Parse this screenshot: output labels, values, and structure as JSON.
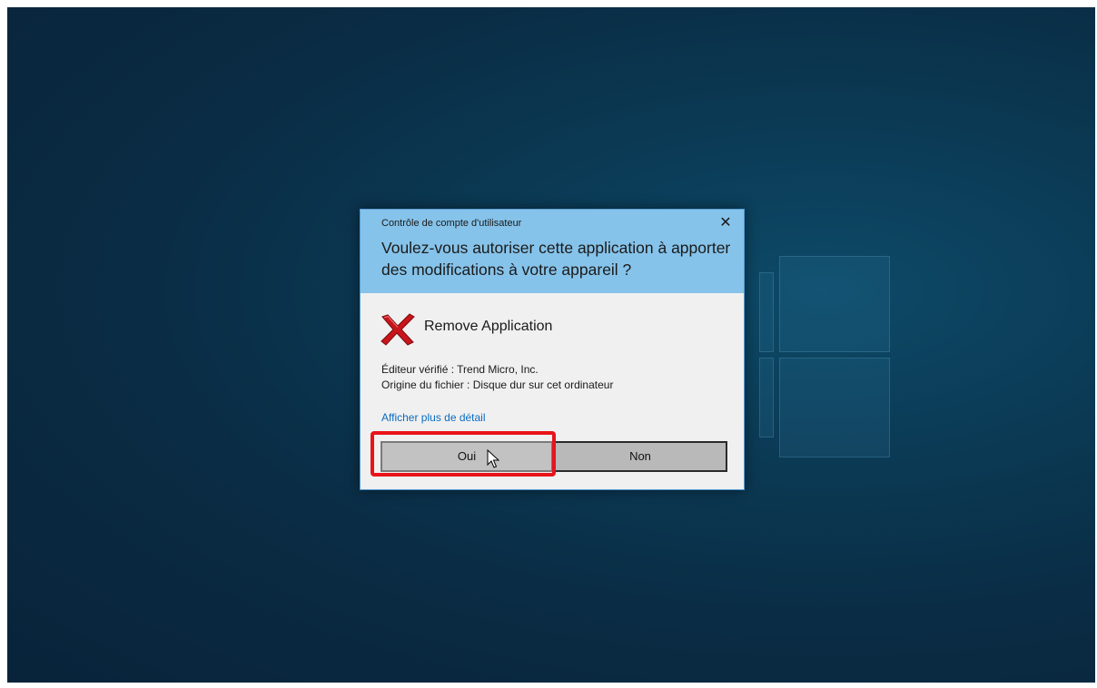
{
  "dialog": {
    "caption": "Contrôle de compte d'utilisateur",
    "question": "Voulez-vous autoriser cette application à apporter des modifications à votre appareil ?",
    "app_name": "Remove Application",
    "publisher": "Éditeur vérifié : Trend Micro, Inc.",
    "origin": "Origine du fichier : Disque dur sur cet ordinateur",
    "details_link": "Afficher plus de détail",
    "yes_label": "Oui",
    "no_label": "Non",
    "close_glyph": "✕"
  },
  "icons": {
    "app": "red-x-icon",
    "close": "close-icon",
    "cursor": "mouse-pointer-icon",
    "logo": "windows-logo-icon"
  },
  "colors": {
    "header": "#86c3ea",
    "link": "#0a6bc2",
    "highlight": "#e8141a",
    "desktop": "#0b3a55"
  }
}
